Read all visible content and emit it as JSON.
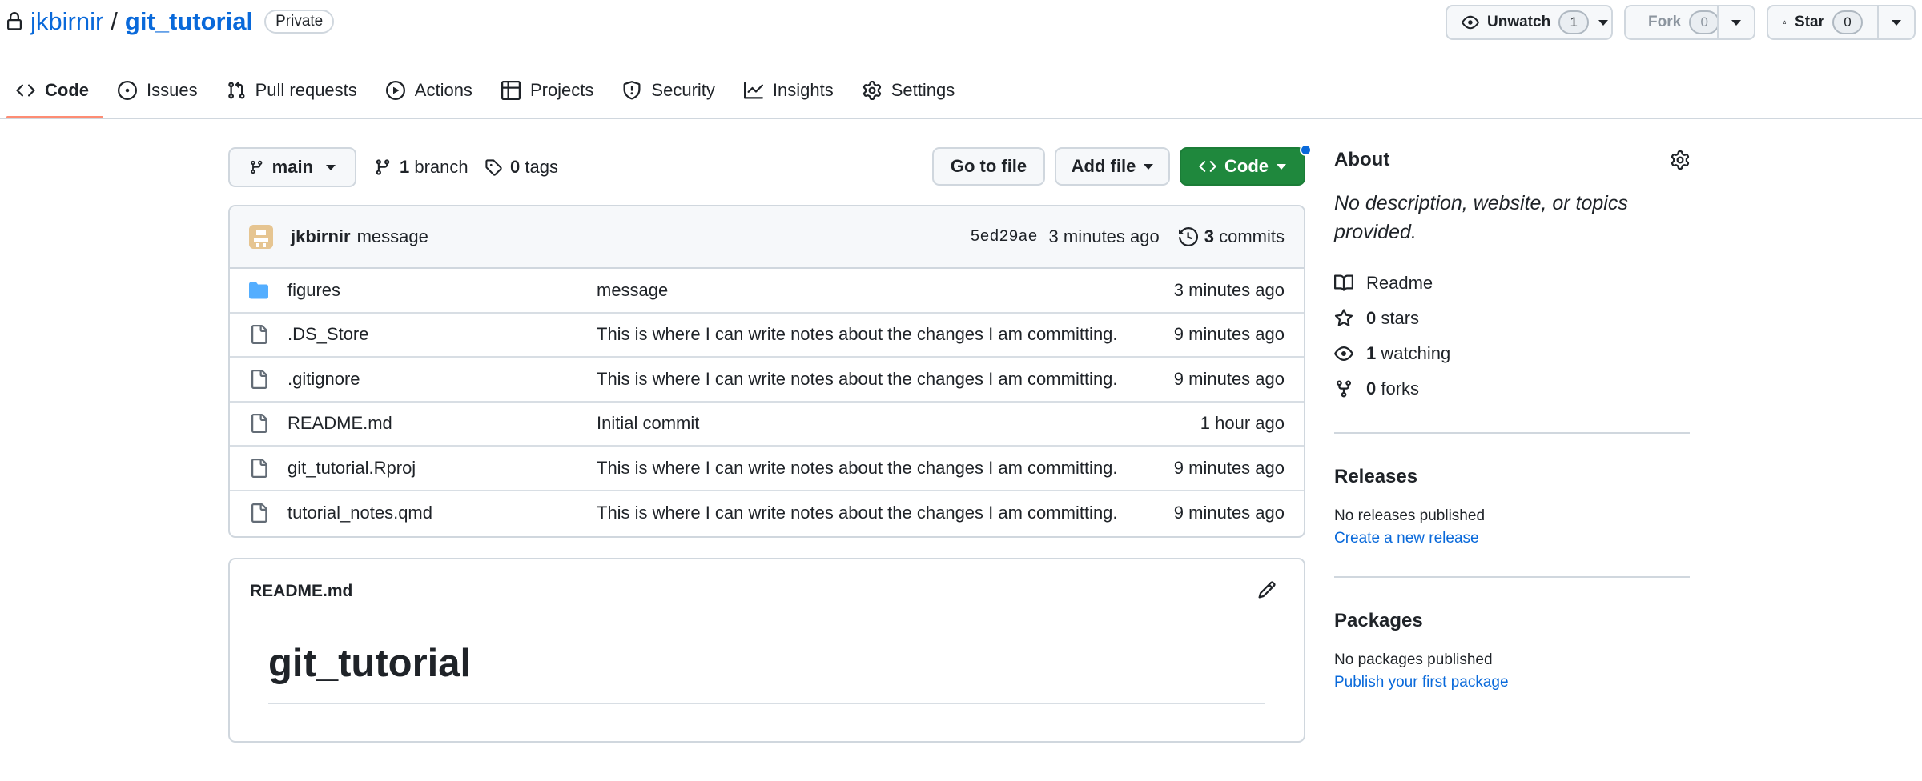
{
  "repo": {
    "owner": "jkbirnir",
    "separator": "/",
    "name": "git_tutorial",
    "visibility": "Private"
  },
  "header_actions": {
    "watch": {
      "label": "Unwatch",
      "count": "1"
    },
    "fork": {
      "label": "Fork",
      "count": "0"
    },
    "star": {
      "label": "Star",
      "count": "0"
    }
  },
  "tabs": [
    {
      "label": "Code",
      "icon": "code-icon",
      "active": true
    },
    {
      "label": "Issues",
      "icon": "issue-opened-icon"
    },
    {
      "label": "Pull requests",
      "icon": "git-pull-request-icon"
    },
    {
      "label": "Actions",
      "icon": "play-icon"
    },
    {
      "label": "Projects",
      "icon": "table-icon"
    },
    {
      "label": "Security",
      "icon": "shield-icon"
    },
    {
      "label": "Insights",
      "icon": "graph-icon"
    },
    {
      "label": "Settings",
      "icon": "gear-icon"
    }
  ],
  "toolbar": {
    "branch": "main",
    "branch_count": "1",
    "branch_label": "branch",
    "tag_count": "0",
    "tag_label": "tags",
    "go_to_file": "Go to file",
    "add_file": "Add file",
    "code": "Code"
  },
  "latest_commit": {
    "author": "jkbirnir",
    "message": "message",
    "sha": "5ed29ae",
    "time": "3 minutes ago",
    "commit_count": "3",
    "commit_label": "commits"
  },
  "files": [
    {
      "name": "figures",
      "type": "dir",
      "message": "message",
      "time": "3 minutes ago"
    },
    {
      "name": ".DS_Store",
      "type": "file",
      "message": "This is where I can write notes about the changes I am committing.",
      "time": "9 minutes ago"
    },
    {
      "name": ".gitignore",
      "type": "file",
      "message": "This is where I can write notes about the changes I am committing.",
      "time": "9 minutes ago"
    },
    {
      "name": "README.md",
      "type": "file",
      "message": "Initial commit",
      "time": "1 hour ago"
    },
    {
      "name": "git_tutorial.Rproj",
      "type": "file",
      "message": "This is where I can write notes about the changes I am committing.",
      "time": "9 minutes ago"
    },
    {
      "name": "tutorial_notes.qmd",
      "type": "file",
      "message": "This is where I can write notes about the changes I am committing.",
      "time": "9 minutes ago"
    }
  ],
  "readme": {
    "filename": "README.md",
    "heading": "git_tutorial"
  },
  "about": {
    "title": "About",
    "description": "No description, website, or topics provided.",
    "readme_label": "Readme",
    "stars_count": "0",
    "stars_label": "stars",
    "watching_count": "1",
    "watching_label": "watching",
    "forks_count": "0",
    "forks_label": "forks"
  },
  "releases": {
    "title": "Releases",
    "status": "No releases published",
    "link": "Create a new release"
  },
  "packages": {
    "title": "Packages",
    "status": "No packages published",
    "link": "Publish your first package"
  },
  "colors": {
    "link": "#0969da",
    "green_button": "#1f883d",
    "active_tab_underline": "#fd8c73",
    "folder": "#54aeff",
    "border": "#d0d7de"
  }
}
